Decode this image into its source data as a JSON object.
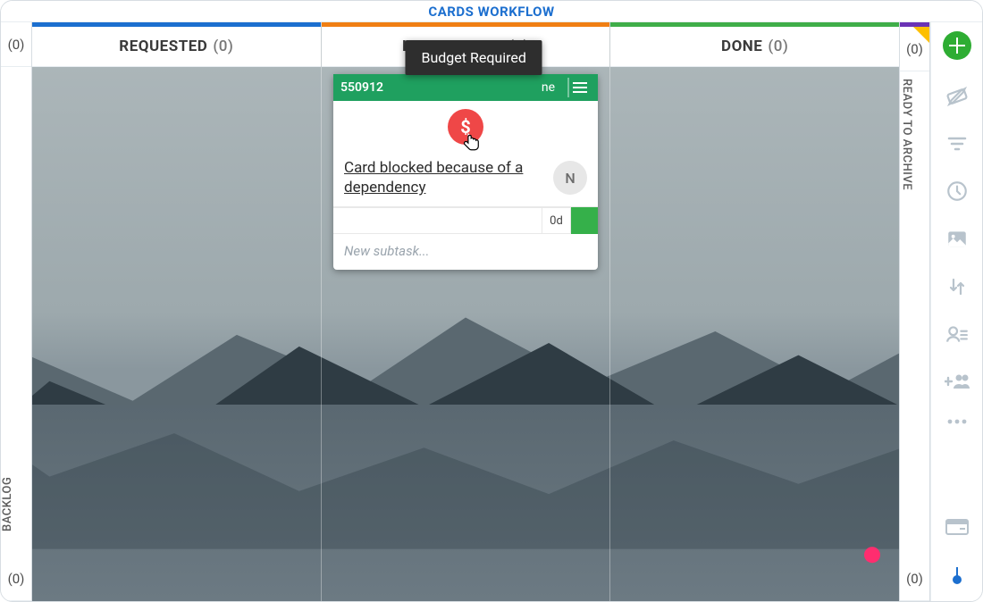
{
  "header": {
    "title": "CARDS WORKFLOW"
  },
  "left_collapsed": {
    "label": "BACKLOG",
    "count_top": "(0)",
    "count_bottom": "(0)"
  },
  "right_collapsed": {
    "label": "READY TO ARCHIVE",
    "count_top": "(0)",
    "count_bottom": "(0)"
  },
  "columns": [
    {
      "name": "REQUESTED",
      "count": "(0)"
    },
    {
      "name": "IN PROGRESS",
      "count": "(1)"
    },
    {
      "name": "DONE",
      "count": "(0)"
    }
  ],
  "card": {
    "id": "550912",
    "assigned_suffix": "ne",
    "tooltip": "Budget Required",
    "blocker_symbol": "$",
    "title": "Card blocked because of a dependency",
    "avatar_initial": "N",
    "subtask_duration": "0d",
    "new_subtask_placeholder": "New subtask..."
  },
  "icons": {
    "add": "plus-icon",
    "ticket": "ticket-icon",
    "filter": "filter-icon",
    "clock": "clock-icon",
    "image": "image-icon",
    "sort": "sort-icon",
    "user_list": "user-list-icon",
    "add_group": "add-group-icon",
    "more": "more-icon",
    "card_settings": "card-settings-icon"
  }
}
